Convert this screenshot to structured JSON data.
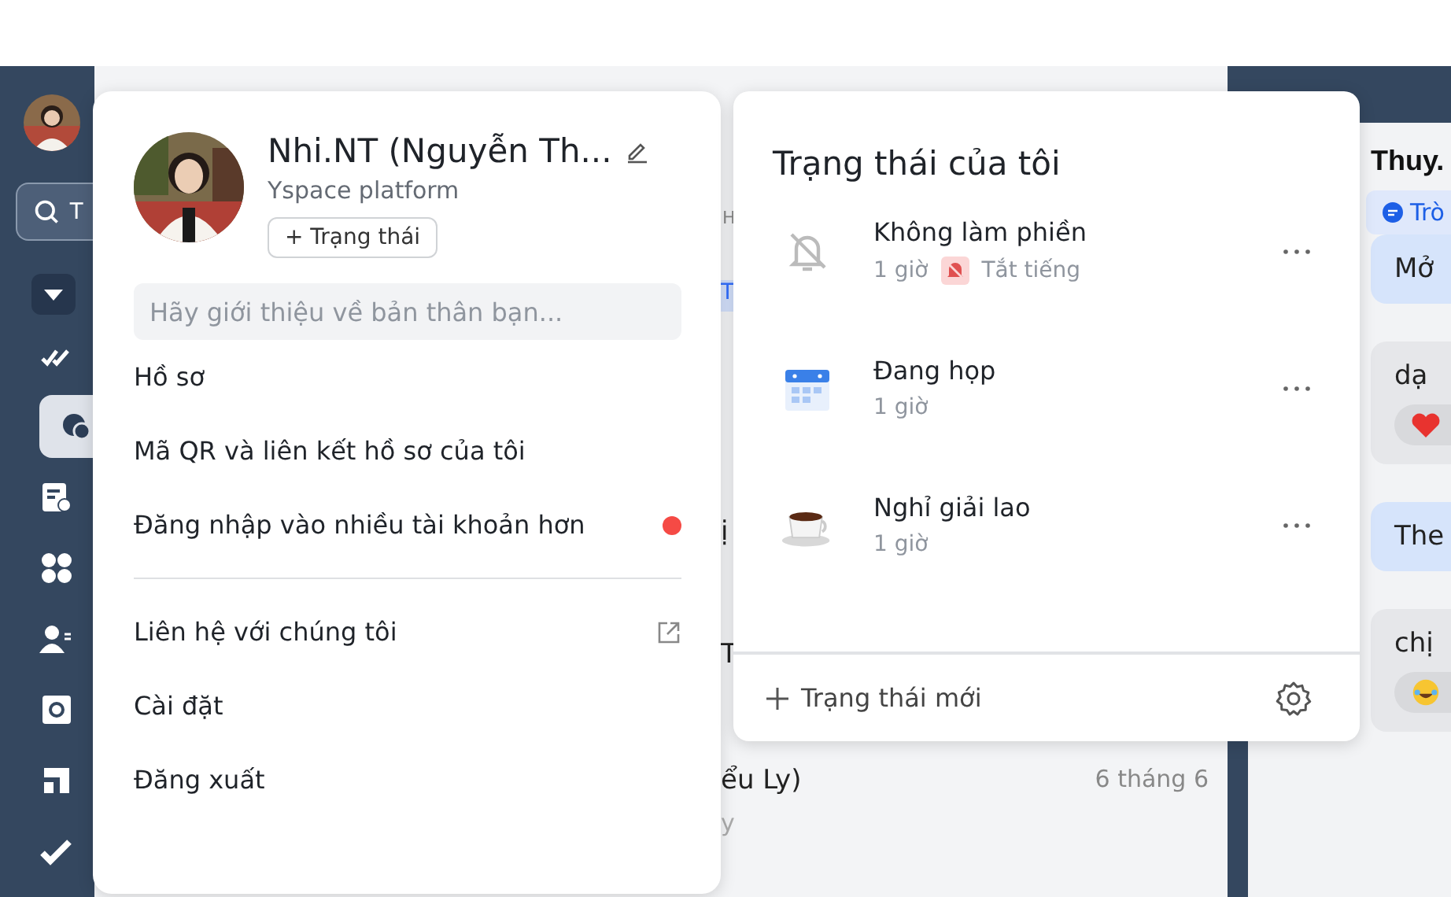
{
  "sidebar": {
    "search": {
      "placeholder": "T"
    },
    "items": [
      {
        "kind": "group",
        "selected": false
      },
      {
        "kind": "checks",
        "selected": false
      },
      {
        "kind": "chat",
        "selected": true
      },
      {
        "kind": "doc",
        "selected": false
      },
      {
        "kind": "apps",
        "selected": false
      },
      {
        "kind": "contacts",
        "selected": false
      },
      {
        "kind": "box",
        "selected": false
      },
      {
        "kind": "feed",
        "selected": false
      },
      {
        "kind": "task",
        "selected": false
      }
    ]
  },
  "chat_list": {
    "fragments": [
      {
        "text": "H",
        "highlight": false
      },
      {
        "text": "T",
        "highlight": true
      },
      {
        "text": "ị",
        "highlight": false
      },
      {
        "text": "T",
        "highlight": false
      }
    ],
    "row": {
      "title": "ểu Ly)",
      "date": "6 tháng 6",
      "preview": "y"
    }
  },
  "conversation": {
    "title": "Thuy.",
    "tag": "Trò",
    "messages": [
      {
        "kind": "plain",
        "mine": true,
        "text": "Mở"
      },
      {
        "kind": "heart",
        "mine": false,
        "text": "dạ"
      },
      {
        "kind": "plain",
        "mine": true,
        "text": "The"
      },
      {
        "kind": "laugh",
        "mine": false,
        "text": "chị"
      }
    ]
  },
  "profile_card": {
    "name": "Nhi.NT (Nguyễn Th...",
    "org": "Yspace platform",
    "status_button": "+ Trạng thái",
    "bio_placeholder": "Hãy giới thiệu về bản thân bạn...",
    "menu_sections": [
      [
        {
          "label": "Hồ sơ",
          "notification": false,
          "external": false
        },
        {
          "label": "Mã QR và liên kết hồ sơ của tôi",
          "notification": false,
          "external": false
        },
        {
          "label": "Đăng nhập vào nhiều tài khoản hơn",
          "notification": true,
          "external": false
        }
      ],
      [
        {
          "label": "Liên hệ với chúng tôi",
          "notification": false,
          "external": true
        },
        {
          "label": "Cài đặt",
          "notification": false,
          "external": false
        },
        {
          "label": "Đăng xuất",
          "notification": false,
          "external": false
        }
      ]
    ]
  },
  "status_card": {
    "title": "Trạng thái của tôi",
    "statuses": [
      {
        "kind": "dnd",
        "name": "Không làm phiền",
        "duration": "1 giờ",
        "tag": "Tắt tiếng"
      },
      {
        "kind": "meeting",
        "name": "Đang họp",
        "duration": "1 giờ"
      },
      {
        "kind": "break",
        "name": "Nghỉ giải lao",
        "duration": "1 giờ"
      }
    ],
    "new_status": "Trạng thái mới"
  }
}
